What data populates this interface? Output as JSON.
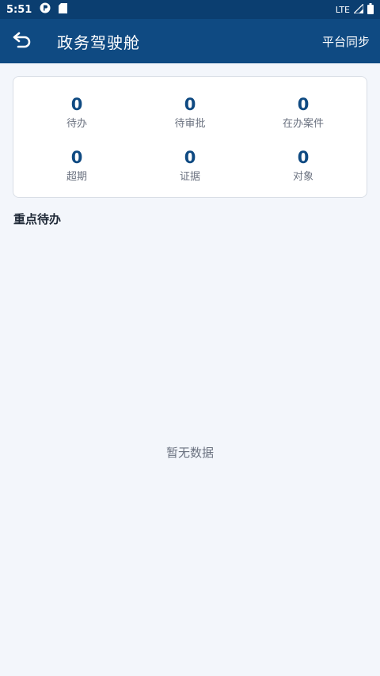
{
  "status_bar": {
    "time": "5:51",
    "network": "LTE"
  },
  "header": {
    "title": "政务驾驶舱",
    "sync_label": "平台同步"
  },
  "stats": [
    {
      "value": "0",
      "label": "待办"
    },
    {
      "value": "0",
      "label": "待审批"
    },
    {
      "value": "0",
      "label": "在办案件"
    },
    {
      "value": "0",
      "label": "超期"
    },
    {
      "value": "0",
      "label": "证据"
    },
    {
      "value": "0",
      "label": "对象"
    }
  ],
  "section": {
    "title": "重点待办",
    "empty_text": "暂无数据"
  },
  "colors": {
    "primary": "#0f4a82",
    "status_bar": "#0b3e70",
    "background": "#f3f6fb"
  }
}
